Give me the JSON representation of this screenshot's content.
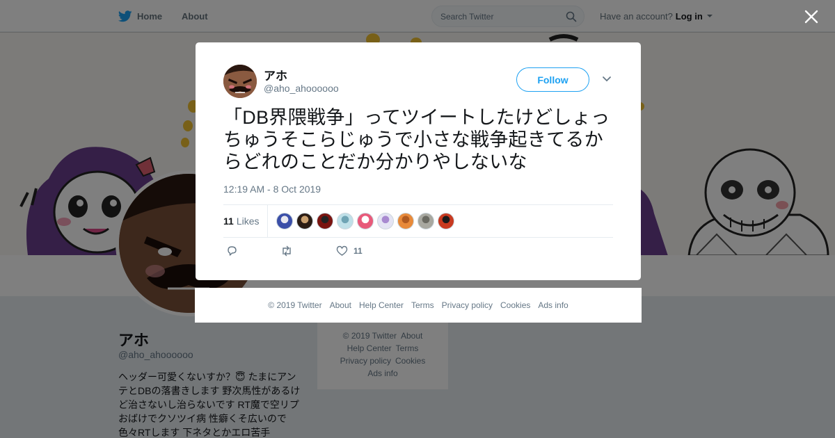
{
  "topbar": {
    "home_label": "Home",
    "about_label": "About",
    "search_placeholder": "Search Twitter",
    "account_prompt": "Have an account?",
    "login_label": "Log in"
  },
  "profile": {
    "name": "アホ",
    "handle": "@aho_ahoooooo",
    "bio": "ヘッダー可愛くないすか？😇 たまにアンテとDBの落書きします 野次馬性があるけど治さないし治らないです RT魔で空リプおばけでクソツイ病 性癖くそ広いので色々RTします 下ネタとかエロ苦手"
  },
  "background_footer": {
    "items": [
      "© 2019 Twitter",
      "About",
      "Help Center",
      "Terms",
      "Privacy policy",
      "Cookies",
      "Ads info"
    ]
  },
  "tweet": {
    "author_name": "アホ",
    "author_handle": "@aho_ahoooooo",
    "follow_label": "Follow",
    "text": "「DB界隈戦争」ってツイートしたけどしょっちゅうそこらじゅうで小さな戦争起きてるからどれのことだか分かりやしないな",
    "timestamp": "12:19 AM - 8 Oct 2019",
    "likes_count": "11",
    "likes_label": "Likes",
    "like_action_count": "11",
    "likers": [
      {
        "color": "#3b4fa8",
        "accent": "#e8e8f0"
      },
      {
        "color": "#2a1c14",
        "accent": "#c8a070"
      },
      {
        "color": "#7a1410",
        "accent": "#222222"
      },
      {
        "color": "#bfe0e8",
        "accent": "#6fa4b4"
      },
      {
        "color": "#e85a7a",
        "accent": "#ffffff"
      },
      {
        "color": "#e4e4f4",
        "accent": "#a88ad0"
      },
      {
        "color": "#e88a3a",
        "accent": "#b05a20"
      },
      {
        "color": "#a8a8a0",
        "accent": "#6a6a62"
      },
      {
        "color": "#c83a20",
        "accent": "#1a1a1a"
      }
    ]
  },
  "modal_footer": {
    "items": [
      "© 2019 Twitter",
      "About",
      "Help Center",
      "Terms",
      "Privacy policy",
      "Cookies",
      "Ads info"
    ]
  },
  "colors": {
    "twitter_blue": "#1da1f2",
    "text_secondary": "#657786",
    "overlay": "rgba(0,0,0,0.5)"
  }
}
